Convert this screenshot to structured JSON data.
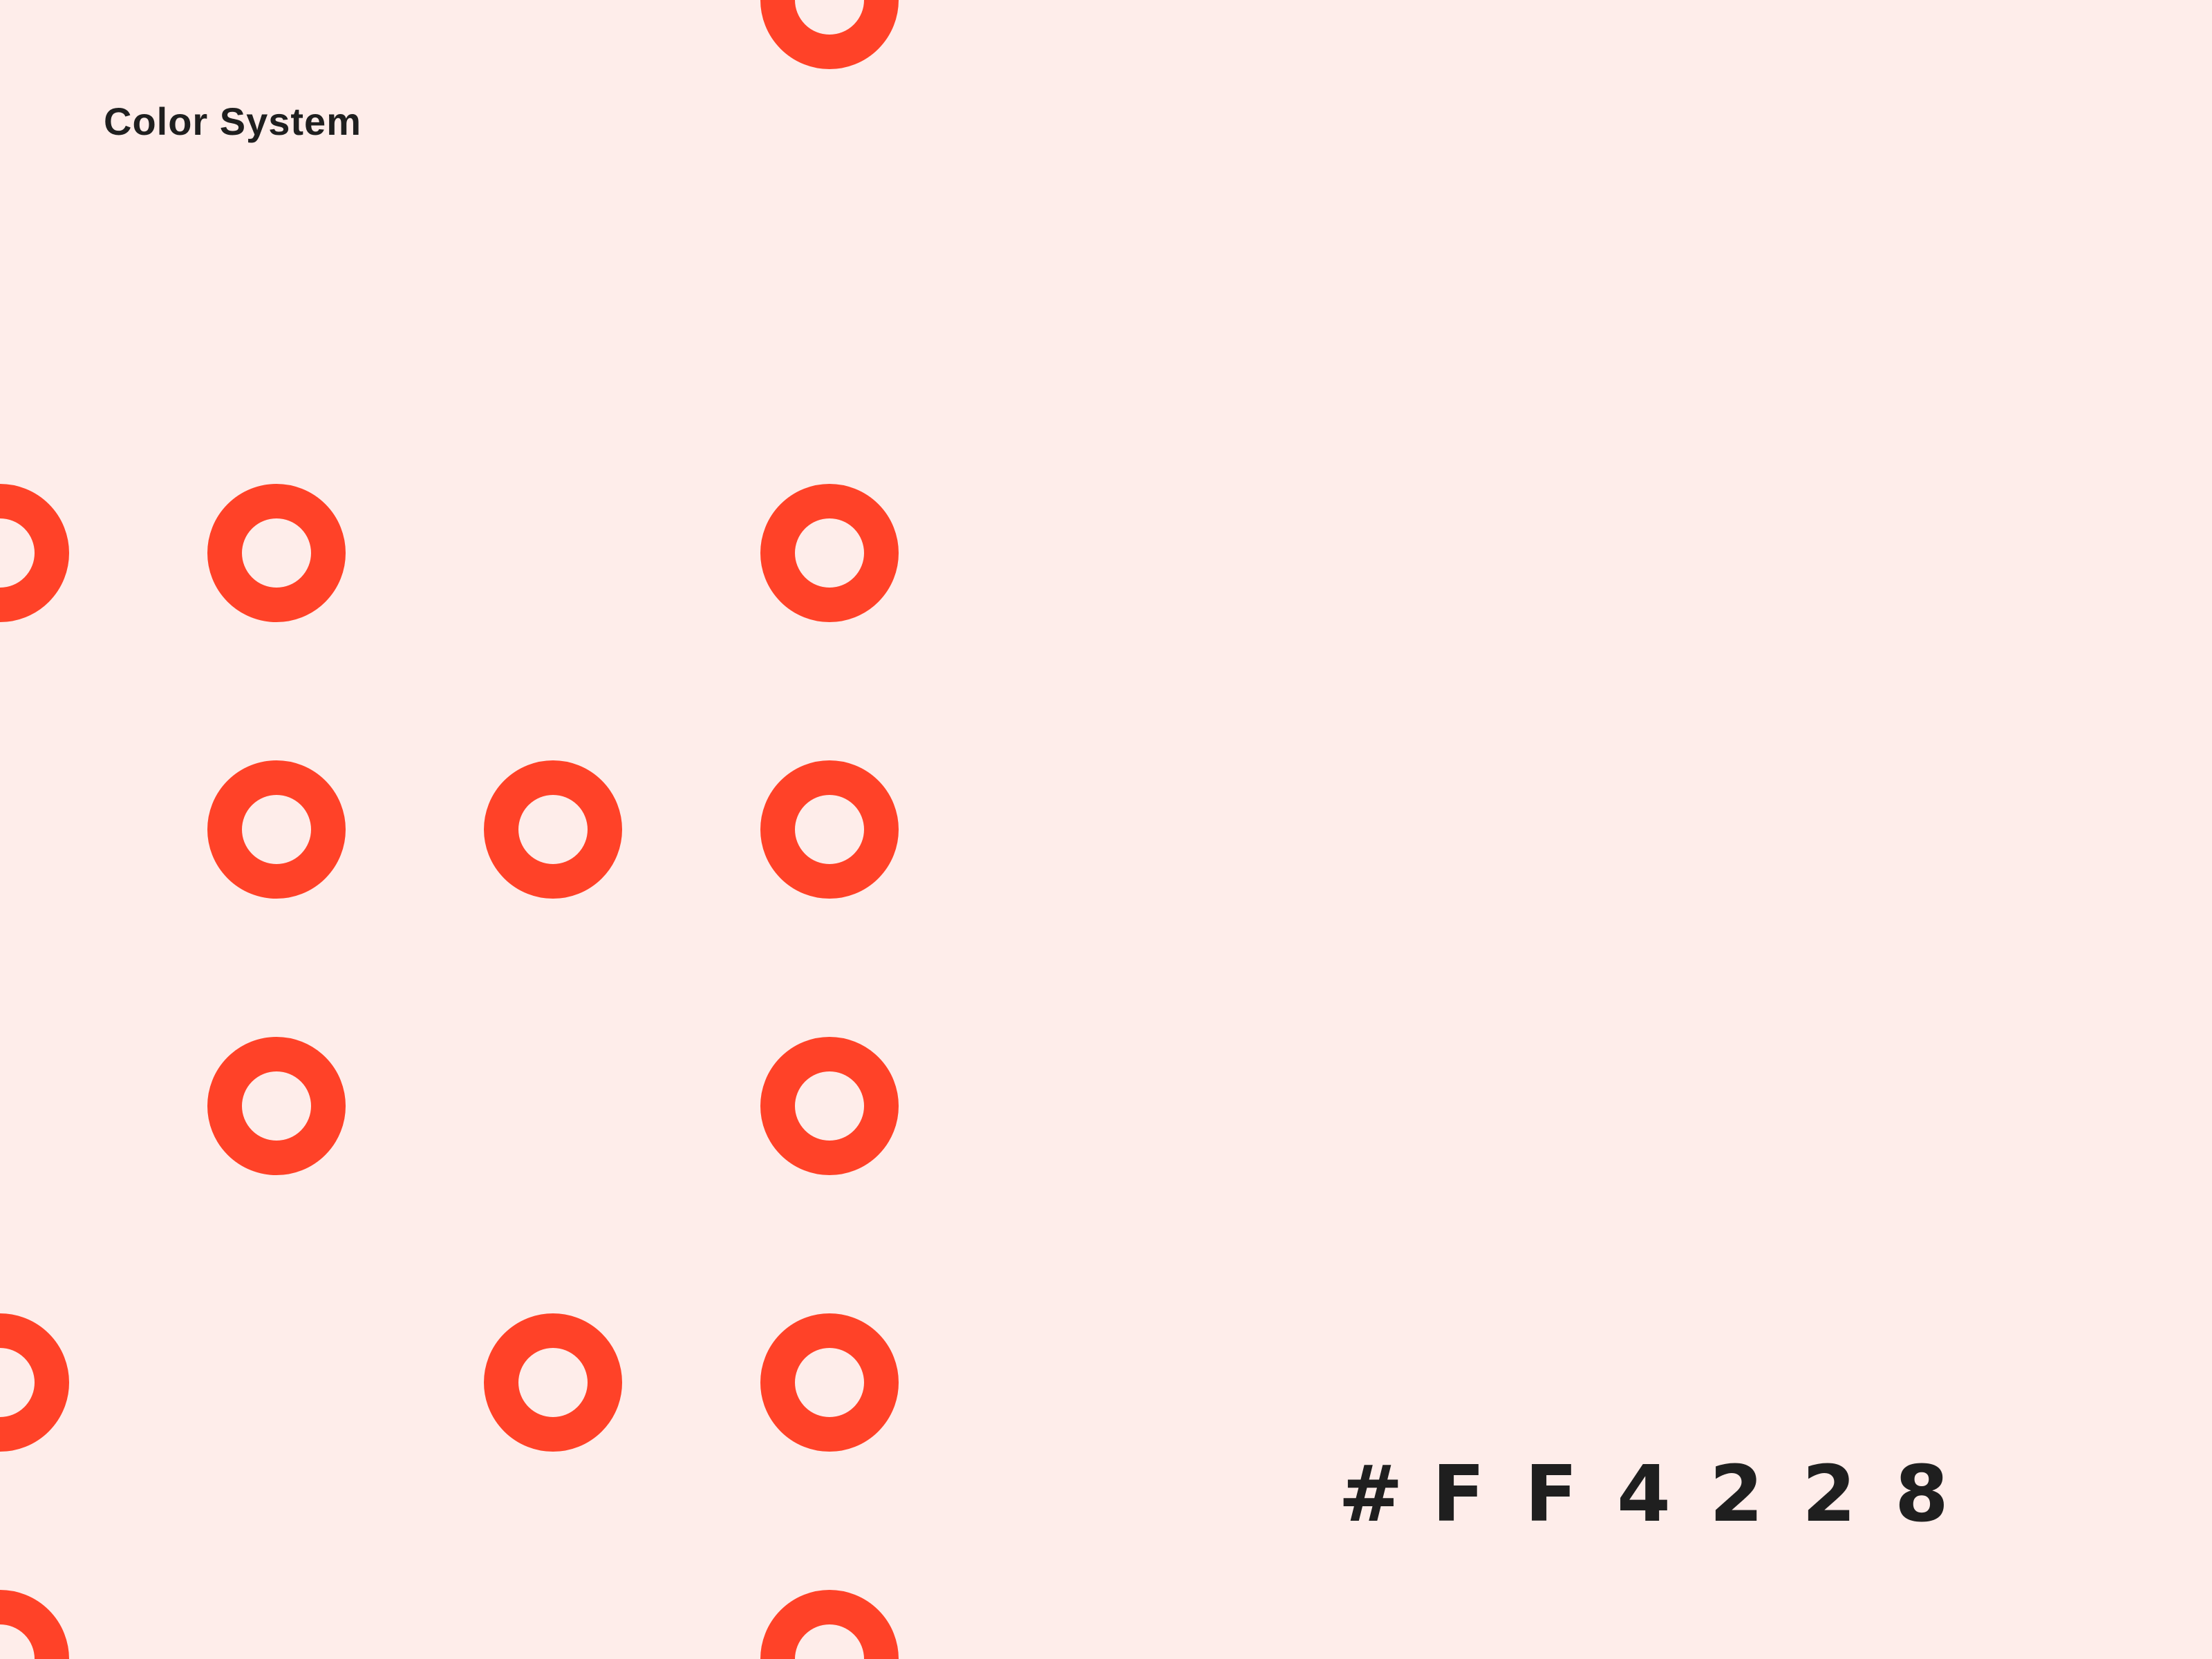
{
  "title": "Color System",
  "color_hex": {
    "label": "#FF4228",
    "characters": [
      "#",
      "F",
      "F",
      "4",
      "2",
      "2",
      "8"
    ]
  },
  "colors": {
    "background": "#FEEDEA",
    "accent": "#FF4228",
    "text": "#1F1F1F"
  },
  "pattern": {
    "icon": "ring-icon",
    "count": 15
  }
}
